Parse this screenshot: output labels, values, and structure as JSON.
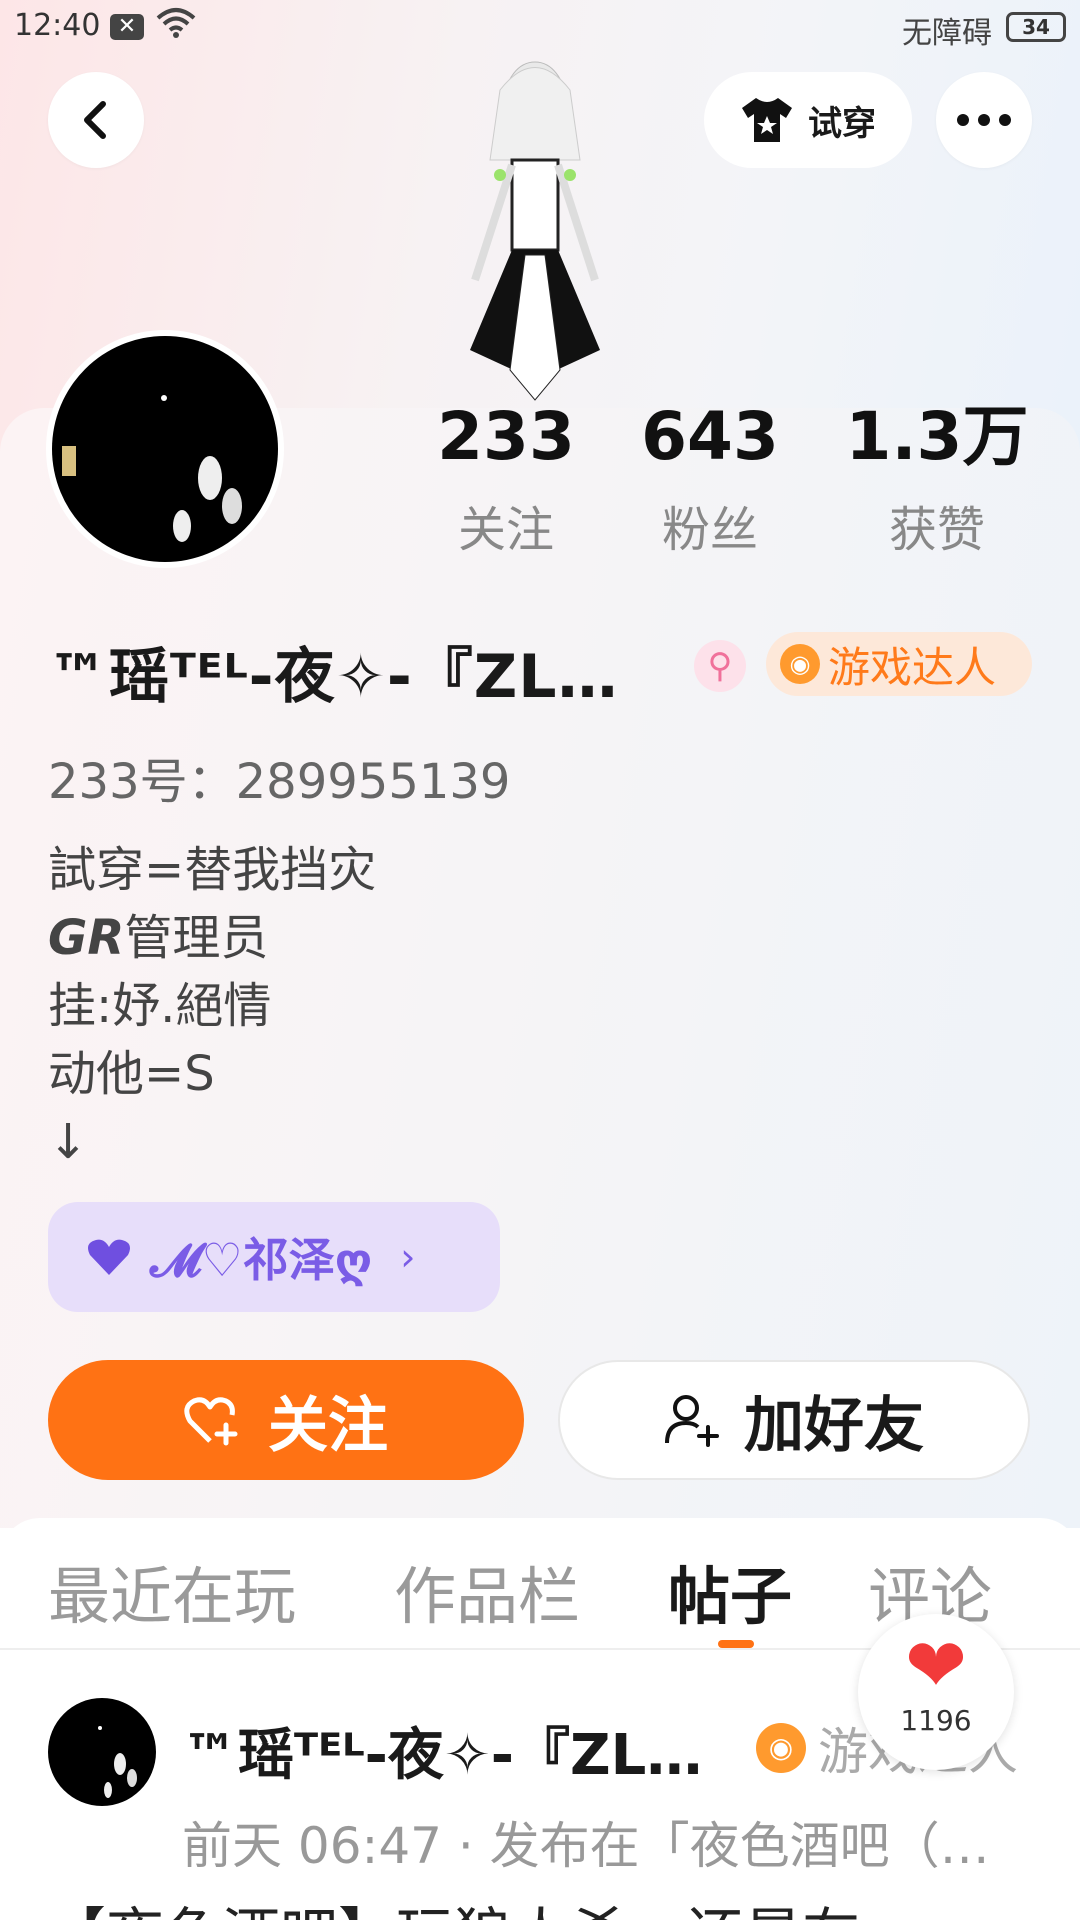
{
  "status_bar": {
    "time": "12:40",
    "accessibility": "无障碍",
    "battery": "34"
  },
  "header": {
    "tryon_label": "试穿"
  },
  "stats": [
    {
      "value": "233",
      "label": "关注"
    },
    {
      "value": "643",
      "label": "粉丝"
    },
    {
      "value": "1.3万",
      "label": "获赞"
    }
  ],
  "profile": {
    "name": "™瑶ᵀᴱᴸ-夜✧-『ZL…",
    "gender_symbol": "⚲",
    "badge": "游戏达人",
    "uid": "233号：289955139",
    "bio_line1": "試穿=替我挡灾",
    "bio_line2_em": "GR",
    "bio_line2": "管理员",
    "bio_line3": "挂:妤.絕情",
    "bio_line4": "动他=S",
    "bio_line5": "↓",
    "cp_name": "𝓜♡祁泽ღ"
  },
  "actions": {
    "follow_label": "关注",
    "add_friend_label": "加好友"
  },
  "tabs": [
    "最近在玩",
    "作品栏",
    "帖子",
    "评论"
  ],
  "active_tab": "帖子",
  "like_count": "1196",
  "post": {
    "author": "™瑶ᵀᴱᴸ-夜✧-『ZL…",
    "badge": "游戏达人",
    "meta": "前天 06:47 · 发布在「夜色酒吧（…",
    "text": "【夜色酒吧】玩狼人杀，还是在"
  },
  "colors": {
    "accent": "#ff7214",
    "badge_text": "#ff7a1a",
    "cp_purple": "#7a5ce6"
  }
}
